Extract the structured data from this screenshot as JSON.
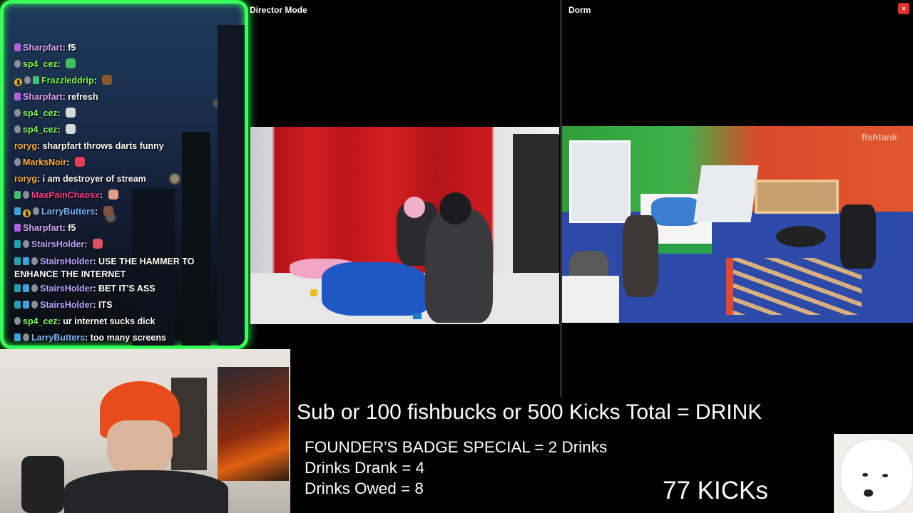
{
  "panes": {
    "director_label": "Director Mode",
    "dorm_label": "Dorm",
    "close_glyph": "×",
    "watermark": "fishtank"
  },
  "chat": {
    "messages": [
      {
        "user": "Sharpfart",
        "text": "f5",
        "color": "#d8a6ff",
        "badges": [
          "purple"
        ],
        "emote": ""
      },
      {
        "user": "sp4_cez",
        "text": "",
        "color": "#7dff5a",
        "badges": [
          "gray"
        ],
        "emote": "#3fbf60"
      },
      {
        "user": "Frazzleddrip",
        "text": "",
        "color": "#7dff5a",
        "badges": [
          "gold",
          "gray",
          "green"
        ],
        "emote": "#8a5a2a"
      },
      {
        "user": "Sharpfart",
        "text": "refresh",
        "color": "#d8a6ff",
        "badges": [
          "purple"
        ],
        "emote": ""
      },
      {
        "user": "sp4_cez",
        "text": "",
        "color": "#7dff5a",
        "badges": [
          "gray"
        ],
        "emote": "#d8d8d8"
      },
      {
        "user": "sp4_cez",
        "text": "",
        "color": "#7dff5a",
        "badges": [
          "gray"
        ],
        "emote": "#d8d8d8"
      },
      {
        "user": "roryg",
        "text": "sharpfart throws darts funny",
        "color": "#ffb340",
        "badges": [],
        "emote": ""
      },
      {
        "user": "MarksNoir",
        "text": "",
        "color": "#ffb340",
        "badges": [
          "gray"
        ],
        "emote": "#e04050"
      },
      {
        "user": "roryg",
        "text": "i am destroyer of stream",
        "color": "#ffb340",
        "badges": [],
        "emote": ""
      },
      {
        "user": "MaxPainChaosx",
        "text": "",
        "color": "#ff3b8d",
        "badges": [
          "green",
          "gray"
        ],
        "emote": "#e0a080"
      },
      {
        "user": "LarryButters",
        "text": "",
        "color": "#7ab8ff",
        "badges": [
          "blue",
          "gold",
          "gray"
        ],
        "emote": "#805040"
      },
      {
        "user": "Sharpfart",
        "text": "f5",
        "color": "#d8a6ff",
        "badges": [
          "purple"
        ],
        "emote": ""
      },
      {
        "user": "StairsHolder",
        "text": "",
        "color": "#b9a6ff",
        "badges": [
          "teal",
          "gray"
        ],
        "emote": "#e05060"
      },
      {
        "user": "StairsHolder",
        "text": "USE THE HAMMER TO ENHANCE THE INTERNET",
        "color": "#b9a6ff",
        "badges": [
          "teal",
          "blue",
          "gray"
        ],
        "emote": "",
        "wrap": true
      },
      {
        "user": "StairsHolder",
        "text": "BET IT'S ASS",
        "color": "#b9a6ff",
        "badges": [
          "teal",
          "blue",
          "gray"
        ],
        "emote": ""
      },
      {
        "user": "StairsHolder",
        "text": "ITS",
        "color": "#b9a6ff",
        "badges": [
          "teal",
          "blue",
          "gray"
        ],
        "emote": ""
      },
      {
        "user": "sp4_cez",
        "text": "ur internet sucks dick",
        "color": "#7dff5a",
        "badges": [
          "gray"
        ],
        "emote": ""
      },
      {
        "user": "LarryButters",
        "text": "too many screens",
        "color": "#7ab8ff",
        "badges": [
          "blue",
          "gray"
        ],
        "emote": ""
      }
    ]
  },
  "overlay": {
    "headline": "Sub or 100 fishbucks or 500 Kicks Total = DRINK",
    "founders": "FOUNDER'S BADGE SPECIAL = 2 Drinks",
    "drank": "Drinks Drank = 4",
    "owed": "Drinks Owed = 8",
    "kicks": "77 KICKs"
  },
  "colors": {
    "chat_border": "#39ff5a",
    "close_button": "#e0312e"
  }
}
